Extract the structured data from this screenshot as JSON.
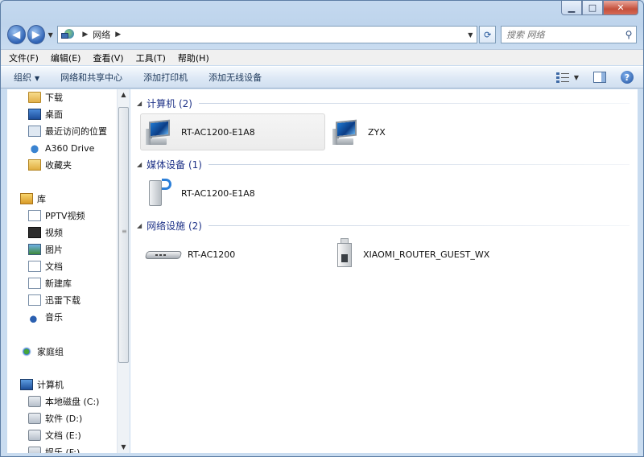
{
  "window": {
    "minimize": "▁",
    "maximize": "□",
    "close": "✕"
  },
  "address": {
    "crumb": "网络",
    "search_placeholder": "搜索 网络"
  },
  "menu": {
    "items": [
      "文件(F)",
      "编辑(E)",
      "查看(V)",
      "工具(T)",
      "帮助(H)"
    ]
  },
  "commands": {
    "organize": "组织",
    "network_center": "网络和共享中心",
    "add_printer": "添加打印机",
    "add_wireless": "添加无线设备"
  },
  "nav": {
    "items": [
      {
        "label": "下载",
        "icon": "folder-icon"
      },
      {
        "label": "桌面",
        "icon": "desktop-icon"
      },
      {
        "label": "最近访问的位置",
        "icon": "recent-places-icon"
      },
      {
        "label": "A360 Drive",
        "icon": "cloud-drive-icon"
      },
      {
        "label": "收藏夹",
        "icon": "favorites-icon"
      },
      {
        "label": "库",
        "icon": "library-icon"
      },
      {
        "label": "PPTV视频",
        "icon": "library-folder-icon"
      },
      {
        "label": "视频",
        "icon": "video-icon"
      },
      {
        "label": "图片",
        "icon": "pictures-icon"
      },
      {
        "label": "文档",
        "icon": "documents-icon"
      },
      {
        "label": "新建库",
        "icon": "library-folder-icon"
      },
      {
        "label": "迅雷下载",
        "icon": "library-folder-icon"
      },
      {
        "label": "音乐",
        "icon": "music-icon"
      },
      {
        "label": "家庭组",
        "icon": "homegroup-icon"
      },
      {
        "label": "计算机",
        "icon": "computer-icon"
      },
      {
        "label": "本地磁盘 (C:)",
        "icon": "drive-icon"
      },
      {
        "label": "软件 (D:)",
        "icon": "drive-icon"
      },
      {
        "label": "文档 (E:)",
        "icon": "drive-icon"
      },
      {
        "label": "娱乐 (F:)",
        "icon": "drive-icon"
      }
    ]
  },
  "groups": {
    "computers": {
      "title": "计算机 (2)",
      "items": [
        {
          "label": "RT-AC1200-E1A8",
          "icon": "computer-icon",
          "selected": true
        },
        {
          "label": "ZYX",
          "icon": "computer-icon",
          "selected": false
        }
      ]
    },
    "media": {
      "title": "媒体设备 (1)",
      "items": [
        {
          "label": "RT-AC1200-E1A8",
          "icon": "media-device-icon"
        }
      ]
    },
    "infrastructure": {
      "title": "网络设施 (2)",
      "items": [
        {
          "label": "RT-AC1200",
          "icon": "router-icon"
        },
        {
          "label": "XIAOMI_ROUTER_GUEST_WX",
          "icon": "access-point-icon"
        }
      ]
    }
  }
}
